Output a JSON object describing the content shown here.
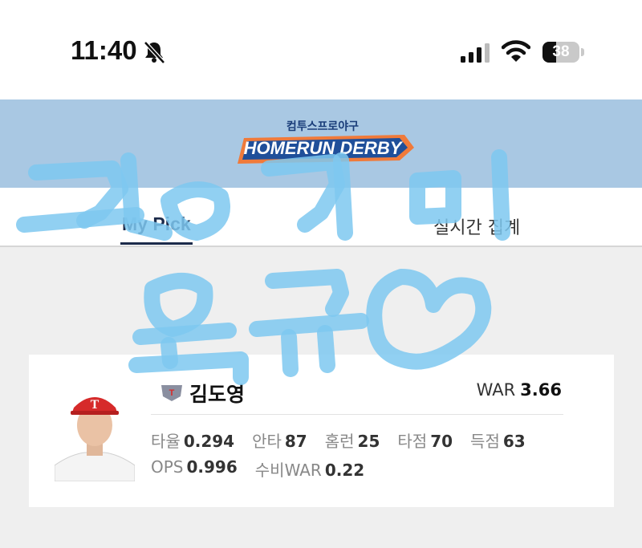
{
  "status_bar": {
    "time": "11:40",
    "battery_level": 38,
    "battery_text": "38"
  },
  "banner": {
    "logo_subtitle": "컴투스프로야구",
    "logo_title": "HOMERUN DERBY"
  },
  "tabs": [
    {
      "label": "My Pick",
      "active": true
    },
    {
      "label": "실시간 집계",
      "active": false
    }
  ],
  "player": {
    "name": "김도영",
    "team_logo": "T",
    "war_label": "WAR",
    "war_value": "3.66",
    "stats_row1": [
      {
        "label": "타율",
        "value": "0.294"
      },
      {
        "label": "안타",
        "value": "87"
      },
      {
        "label": "홈런",
        "value": "25"
      },
      {
        "label": "타점",
        "value": "70"
      },
      {
        "label": "득점",
        "value": "63"
      }
    ],
    "stats_row2": [
      {
        "label": "OPS",
        "value": "0.996"
      },
      {
        "label": "수비WAR",
        "value": "0.22"
      }
    ]
  },
  "colors": {
    "banner_bg": "#a9c8e3",
    "scribble": "#7ec8f0",
    "tab_active": "#1b2a4a",
    "logo_orange": "#f07a3a"
  }
}
